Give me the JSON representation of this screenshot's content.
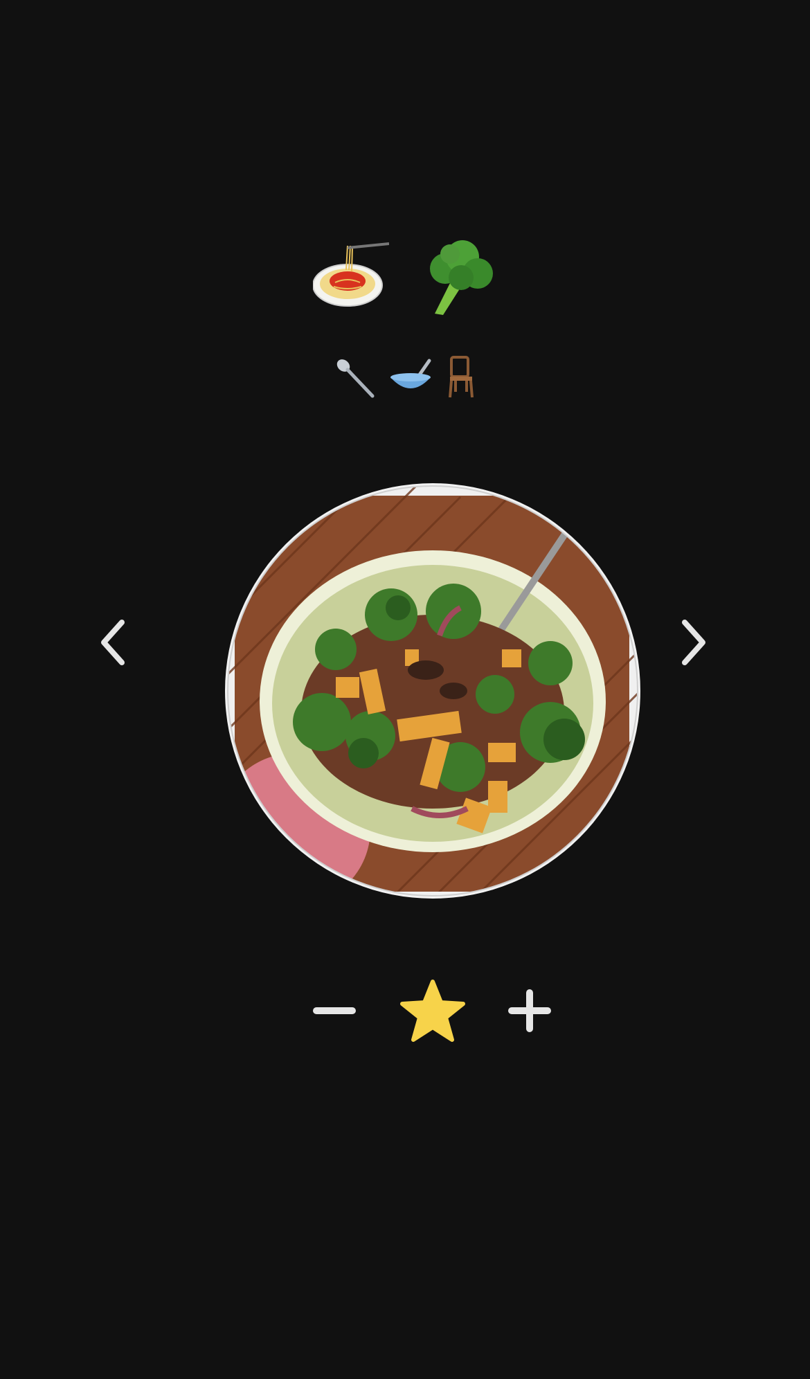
{
  "header": {
    "emoji_large": [
      "spaghetti-emoji",
      "broccoli-emoji"
    ],
    "emoji_small": [
      "spoon-emoji",
      "bowl-with-spoon-emoji",
      "chair-emoji"
    ]
  },
  "carousel": {
    "prev_icon": "chevron-left-icon",
    "next_icon": "chevron-right-icon",
    "photo_subject": "bowl-of-broccoli-and-squash-stir-fry"
  },
  "rating": {
    "decrement_icon": "minus-icon",
    "star_icon": "star-icon",
    "increment_icon": "plus-icon",
    "star_color": "#F7D34A"
  },
  "colors": {
    "background": "#111111",
    "icon": "#E6E6E6"
  }
}
